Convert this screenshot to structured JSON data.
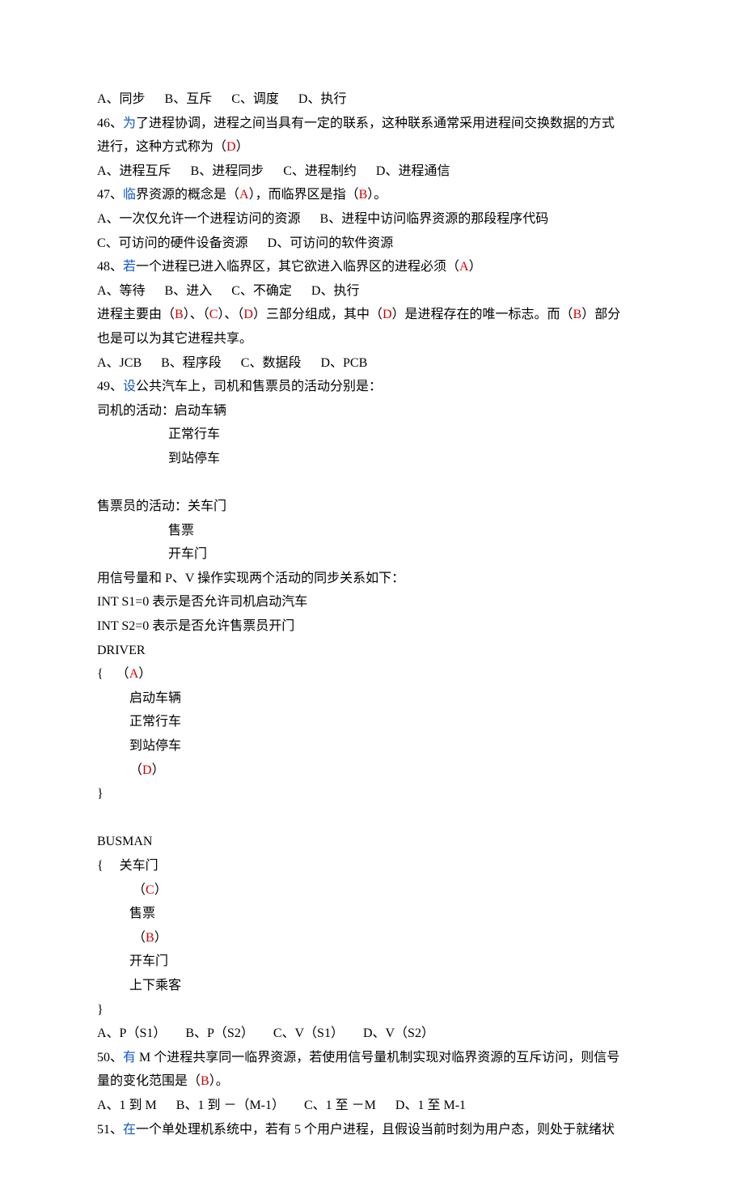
{
  "q45opts": "A、同步      B、互斥      C、调度      D、执行",
  "q46_1": "了进程协调，进程之间当具有一定的联系，这种联系通常采用进程间交换数据的方式",
  "q46_2": "进行，这种方式称为（",
  "q46_opts": "A、进程互斥      B、进程同步      C、进程制约      D、进程通信",
  "q47_1": "界资源的概念是（",
  "q47_2": "），而临界区是指（",
  "q47_3": "）。",
  "q47_opts1": "A、一次仅允许一个进程访问的资源      B、进程中访问临界资源的那段程序代码",
  "q47_opts2": "C、可访问的硬件设备资源      D、可访问的软件资源",
  "q48_1": "一个进程已进入临界区，其它欲进入临界区的进程必须（",
  "q48_opts": "A、等待      B、进入      C、不确定      D、执行",
  "q48_p1a": "进程主要由（",
  "q48_p1b": "）、（",
  "q48_p1c": "）三部分组成，其中（",
  "q48_p1d": "）是进程存在的唯一标志。而（",
  "q48_p1e": "）部分",
  "q48_p2": "也是可以为其它进程共享。",
  "q48_partopts": "A、JCB      B、程序段      C、数据段      D、PCB",
  "q49_1": "公共汽车上，司机和售票员的活动分别是：",
  "driver_t": "司机的活动：启动车辆",
  "driver_1": "正常行车",
  "driver_2": "到站停车",
  "busman_t": "售票员的活动：关车门",
  "busman_1": "售票",
  "busman_2": "开车门",
  "sync_1": "用信号量和 P、V 操作实现两个活动的同步关系如下：",
  "sync_2": "INT S1=0 表示是否允许司机启动汽车",
  "sync_3": "INT S2=0 表示是否允许售票员开门",
  "drv_h": "DRIVER",
  "drv_l1_pre": "{    （",
  "drv_l1_post": "）",
  "drv_l2": "启动车辆",
  "drv_l3": "正常行车",
  "drv_l4": "到站停车",
  "drv_l5_pre": "（",
  "drv_l5_post": "）",
  "close_brace": "}",
  "bus_h": "BUSMAN",
  "bus_l1": "{     关车门",
  "bus_l2_pre": "（",
  "bus_l2_post": "）",
  "bus_l3": "售票",
  "bus_l4_pre": "（",
  "bus_l4_post": "）",
  "bus_l5": "开车门",
  "bus_l6": "上下乘客",
  "q49_opts": "A、P（S1）      B、P（S2）      C、V（S1）      D、V（S2）",
  "q50_1": "M 个进程共享同一临界资源，若使用信号量机制实现对临界资源的互斥访问，则信号",
  "q50_2": "量的变化范围是（",
  "q50_opts": "A、1 到 M      B、1 到 －（M-1）      C、1 至 －M      D、1 至 M-1",
  "q51_1": "一个单处理机系统中，若有 5 个用户进程，且假设当前时刻为用户态，则处于就绪状",
  "n46": "46、",
  "n47": "47、",
  "n48": "48、",
  "n49": "49、",
  "n50": "50、",
  "n51": "51、",
  "kw46": "为",
  "kw47": "临",
  "kw48": "若",
  "kw49": "设",
  "kw50": "有 ",
  "kw51": "在",
  "ansA": "A",
  "ansB": "B",
  "ansC": "C",
  "ansD": "D",
  "closep": "）",
  "closep_period": "）。"
}
